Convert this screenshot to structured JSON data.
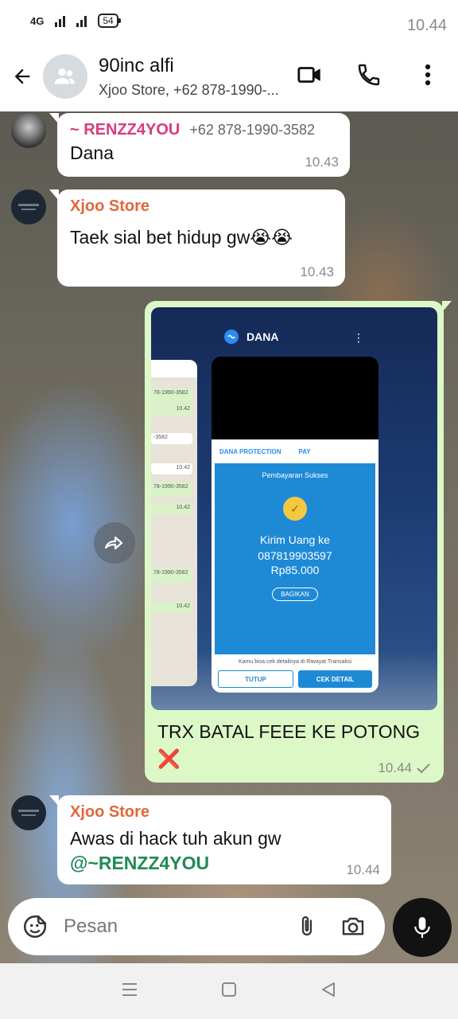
{
  "status_bar": {
    "time": "10.44",
    "network": "4G",
    "battery": "54"
  },
  "header": {
    "title": "90inc alfi",
    "subtitle": "Xjoo Store, +62 878-1990-..."
  },
  "messages": [
    {
      "sender": "~ RENZZ4YOU",
      "phone": "+62 878-1990-3582",
      "text": "Dana",
      "time": "10.43"
    },
    {
      "sender": "Xjoo Store",
      "text": "Taek sial bet hidup gw😭😭",
      "time": "10.43"
    },
    {
      "outgoing_text": "TRX BATAL FEEE KE POTONG ❌",
      "time": "10.44",
      "screenshot": {
        "app_name": "DANA",
        "receipt_brand_1": "DANA PROTECTION",
        "receipt_brand_2": "PAY",
        "status": "Pembayaran Sukses",
        "line1": "Kirim Uang ke",
        "line2": "087819903597",
        "amount": "Rp85.000",
        "share_label": "BAGIKAN",
        "note": "Kamu bisa cek detailnya di Riwayat Transaksi",
        "btn_close": "TUTUP",
        "btn_detail": "CEK DETAIL",
        "side_rows": [
          "78-1990-3582",
          "10.42",
          "-3582",
          "10.42",
          "78-1990-3582",
          "10.42",
          "78-1990-3582",
          "10.42"
        ]
      }
    },
    {
      "sender": "Xjoo Store",
      "text": "Awas di hack tuh akun gw",
      "mention": "@~RENZZ4YOU",
      "time": "10.44"
    }
  ],
  "input": {
    "placeholder": "Pesan"
  },
  "colors": {
    "outgoing_bubble": "#dcf8c6",
    "sender_orange": "#e2673c",
    "sender_pink": "#d63c7c",
    "mention_green": "#1f8a57"
  }
}
